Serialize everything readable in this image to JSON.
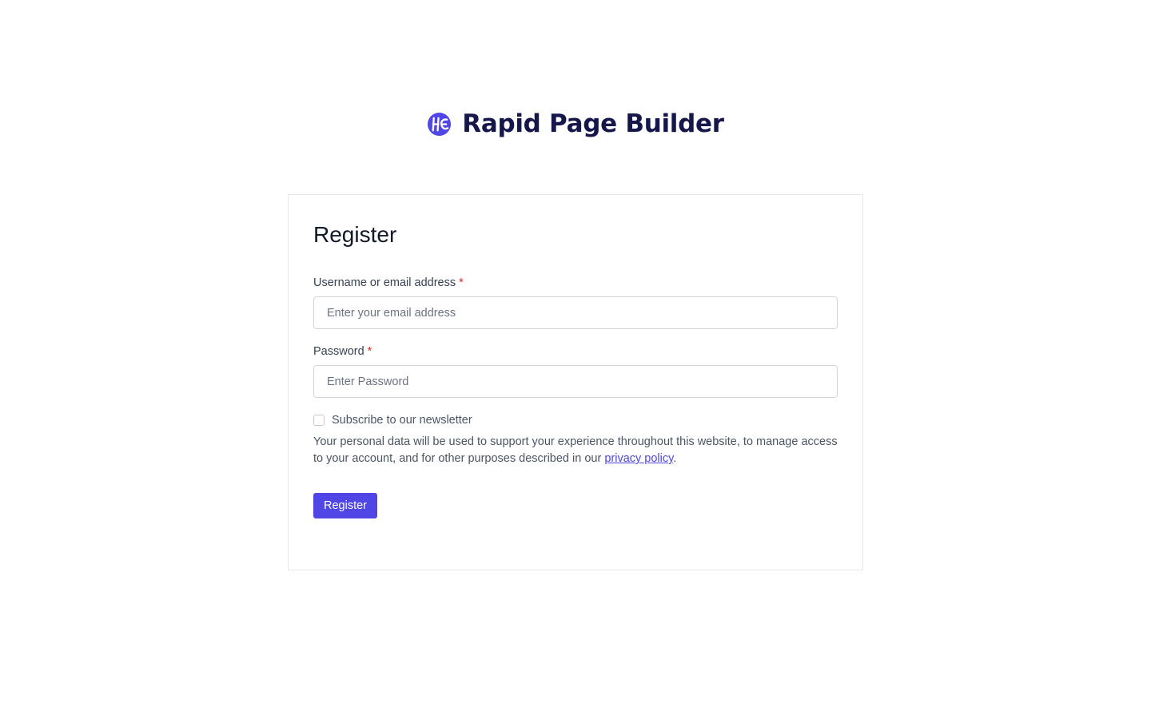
{
  "brand": {
    "name": "Rapid Page Builder",
    "logo_icon": "brand-logo-icon",
    "color": "#15174a",
    "logo_color": "#4f46e5"
  },
  "form": {
    "title": "Register",
    "username": {
      "label": "Username or email address",
      "required_mark": "*",
      "placeholder": "Enter your email address",
      "value": ""
    },
    "password": {
      "label": "Password",
      "required_mark": "*",
      "placeholder": "Enter Password",
      "value": ""
    },
    "newsletter": {
      "label": "Subscribe to our newsletter",
      "checked": false
    },
    "privacy": {
      "text_before": "Your personal data will be used to support your experience throughout this website, to manage access to your account, and for other purposes described in our ",
      "link_text": "privacy policy",
      "text_after": "."
    },
    "submit_label": "Register"
  },
  "colors": {
    "accent": "#4f46e5",
    "required": "#dc2626",
    "border": "#e5e7eb"
  }
}
